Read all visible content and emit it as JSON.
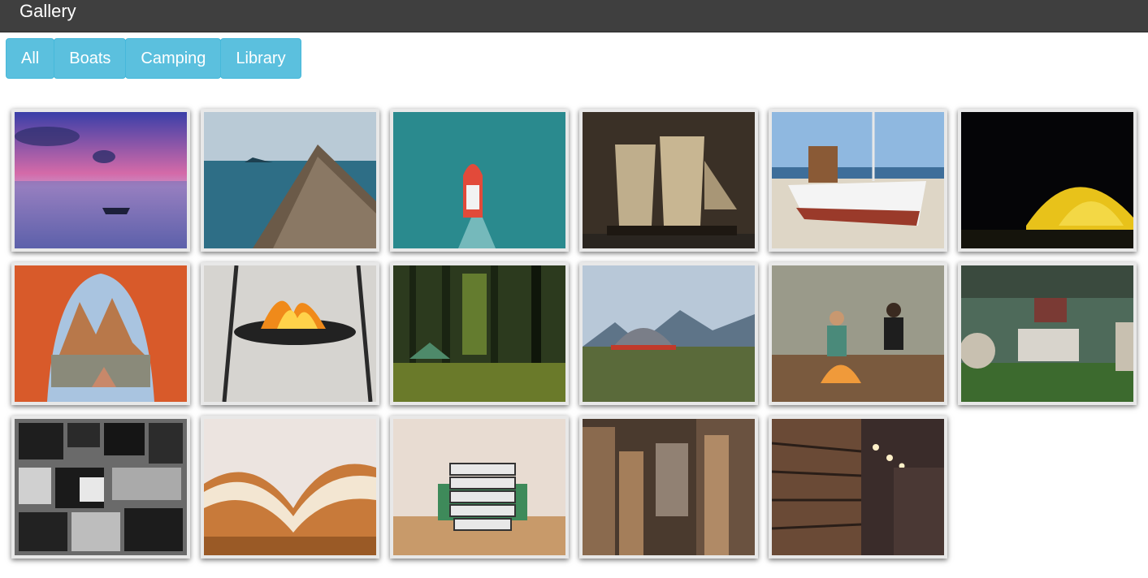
{
  "header": {
    "title": "Gallery"
  },
  "filters": [
    {
      "label": "All"
    },
    {
      "label": "Boats"
    },
    {
      "label": "Camping"
    },
    {
      "label": "Library"
    }
  ],
  "colors": {
    "header_bg": "#3f3f3f",
    "button_bg": "#5bc0de",
    "button_text": "#ffffff"
  },
  "photos": [
    {
      "category": "Boats",
      "subject": "rowboat-sunset-lake"
    },
    {
      "category": "Boats",
      "subject": "longtail-boat-bow-sea"
    },
    {
      "category": "Boats",
      "subject": "speedboat-aerial-teal-water"
    },
    {
      "category": "Boats",
      "subject": "tall-ship-sails"
    },
    {
      "category": "Boats",
      "subject": "fishing-boat-on-beach"
    },
    {
      "category": "Camping",
      "subject": "yellow-tent-night"
    },
    {
      "category": "Camping",
      "subject": "tent-view-mountains"
    },
    {
      "category": "Camping",
      "subject": "campfire-grill"
    },
    {
      "category": "Camping",
      "subject": "tent-in-forest"
    },
    {
      "category": "Camping",
      "subject": "tent-mountain-meadow"
    },
    {
      "category": "Camping",
      "subject": "campfire-two-people"
    },
    {
      "category": "Camping",
      "subject": "glamping-tent-interior"
    },
    {
      "category": "Library",
      "subject": "books-and-speakers-wall"
    },
    {
      "category": "Library",
      "subject": "open-book-closeup"
    },
    {
      "category": "Library",
      "subject": "book-stack-person"
    },
    {
      "category": "Library",
      "subject": "piles-of-books"
    },
    {
      "category": "Library",
      "subject": "library-shelves-lights"
    }
  ]
}
